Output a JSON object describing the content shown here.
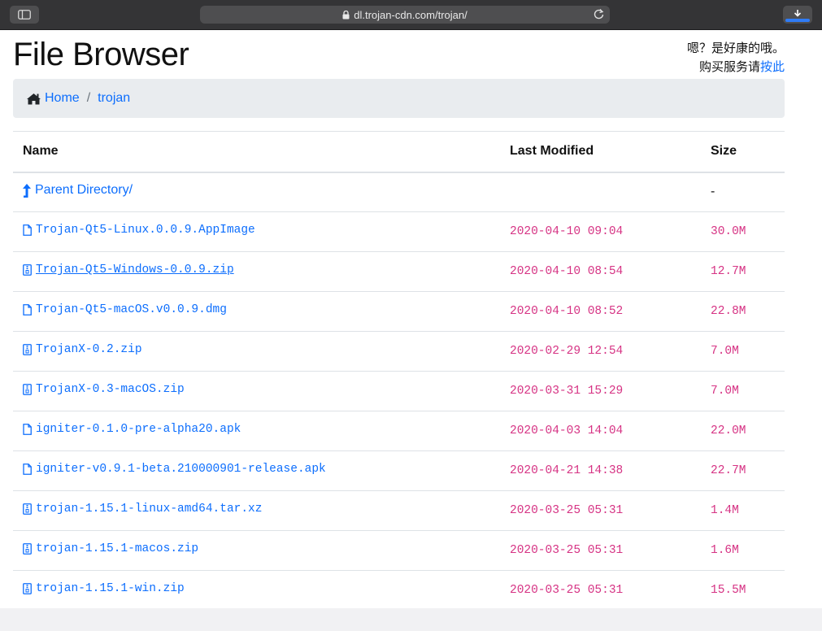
{
  "browser": {
    "url": "dl.trojan-cdn.com/trojan/"
  },
  "page": {
    "title": "File Browser",
    "note_line1": "嗯？是好康的哦。",
    "note_line2_prefix": "购买服务请",
    "note_line2_link": "按此"
  },
  "breadcrumb": {
    "home": "Home",
    "separator": "/",
    "current": "trojan"
  },
  "table": {
    "headers": {
      "name": "Name",
      "modified": "Last Modified",
      "size": "Size"
    },
    "parent": {
      "name": "Parent Directory/",
      "size": "-"
    },
    "rows": [
      {
        "name": "Trojan-Qt5-Linux.0.0.9.AppImage",
        "modified": "2020-04-10 09:04",
        "size": "30.0M",
        "icon": "file-icon"
      },
      {
        "name": "Trojan-Qt5-Windows-0.0.9.zip",
        "modified": "2020-04-10 08:54",
        "size": "12.7M",
        "icon": "zip-file-icon"
      },
      {
        "name": "Trojan-Qt5-macOS.v0.0.9.dmg",
        "modified": "2020-04-10 08:52",
        "size": "22.8M",
        "icon": "file-icon"
      },
      {
        "name": "TrojanX-0.2.zip",
        "modified": "2020-02-29 12:54",
        "size": "7.0M",
        "icon": "zip-file-icon"
      },
      {
        "name": "TrojanX-0.3-macOS.zip",
        "modified": "2020-03-31 15:29",
        "size": "7.0M",
        "icon": "zip-file-icon"
      },
      {
        "name": "igniter-0.1.0-pre-alpha20.apk",
        "modified": "2020-04-03 14:04",
        "size": "22.0M",
        "icon": "file-icon"
      },
      {
        "name": "igniter-v0.9.1-beta.210000901-release.apk",
        "modified": "2020-04-21 14:38",
        "size": "22.7M",
        "icon": "file-icon"
      },
      {
        "name": "trojan-1.15.1-linux-amd64.tar.xz",
        "modified": "2020-03-25 05:31",
        "size": "1.4M",
        "icon": "zip-file-icon"
      },
      {
        "name": "trojan-1.15.1-macos.zip",
        "modified": "2020-03-25 05:31",
        "size": "1.6M",
        "icon": "zip-file-icon"
      },
      {
        "name": "trojan-1.15.1-win.zip",
        "modified": "2020-03-25 05:31",
        "size": "15.5M",
        "icon": "zip-file-icon"
      }
    ]
  },
  "colors": {
    "link": "#0d6efd",
    "code": "#d63384",
    "chrome": "#343436",
    "download_progress": "#2f7cf6"
  }
}
